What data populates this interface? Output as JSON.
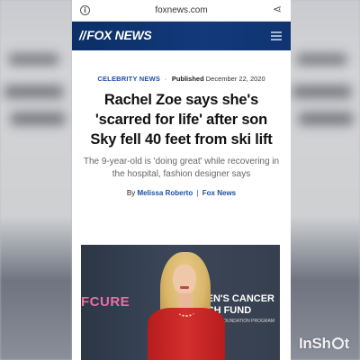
{
  "browser": {
    "url": "foxnews.com",
    "info_icon": "info-icon",
    "share_icon": "share-icon"
  },
  "site": {
    "logo_text": "FOX NEWS",
    "menu_icon": "menu-icon"
  },
  "article": {
    "category": "CELEBRITY NEWS",
    "published_label": "Published",
    "published_date": "December 22, 2020",
    "headline": "Rachel Zoe says she's 'scarred for life' after son Sky fell 40 feet from ski lift",
    "subheadline": "The 9-year-old is 'doing great' while recovering in the hospital, fashion designer says",
    "byline_prefix": "By",
    "author": "Melissa Roberto",
    "byline_separator": "|",
    "outlet": "Fox News"
  },
  "photo": {
    "backdrop_left": "FCURE",
    "backdrop_right_line1": "EN'S CANCER",
    "backdrop_right_line2": "CH FUND",
    "backdrop_small": "FOUNDATION PROGRAM"
  },
  "watermark": {
    "text_before": "InSh",
    "text_after": "t"
  },
  "colors": {
    "header_bg": "#12397a",
    "link_blue": "#1c4fa3",
    "dress_red": "#d32f2f"
  }
}
